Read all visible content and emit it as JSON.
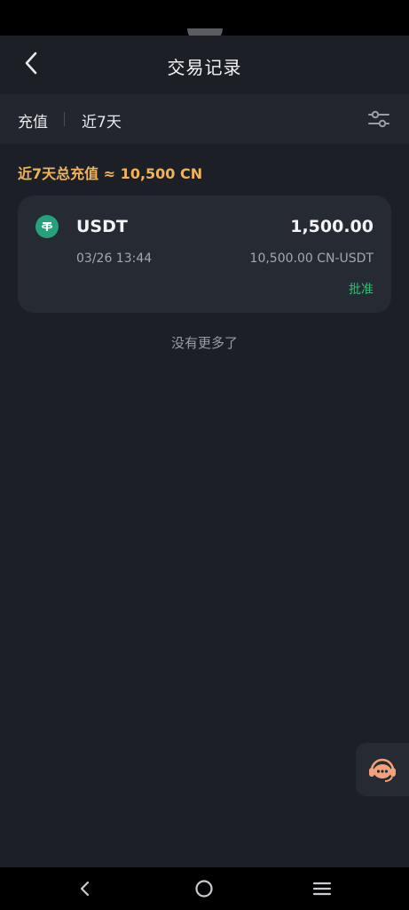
{
  "header": {
    "title": "交易记录",
    "back_icon": "chevron-left-icon"
  },
  "filter": {
    "type_label": "充值",
    "period_label": "近7天",
    "filter_icon": "sliders-icon"
  },
  "summary": {
    "text": "近7天总充值 ≈ 10,500 CN"
  },
  "records": [
    {
      "coin": "USDT",
      "coin_icon": "tether-icon",
      "amount": "1,500.00",
      "datetime": "03/26 13:44",
      "fiat_amount": "10,500.00 CN-USDT",
      "status": "批准",
      "status_color": "#2fbf74"
    }
  ],
  "footer_text": "没有更多了",
  "support": {
    "icon": "customer-service-icon"
  },
  "nav": {
    "back_icon": "nav-back-icon",
    "home_icon": "nav-home-icon",
    "menu_icon": "nav-menu-icon"
  },
  "colors": {
    "background": "#1c1f26",
    "card": "#262a32",
    "accent_orange": "#f0b35b",
    "tether_green": "#26a17b"
  }
}
